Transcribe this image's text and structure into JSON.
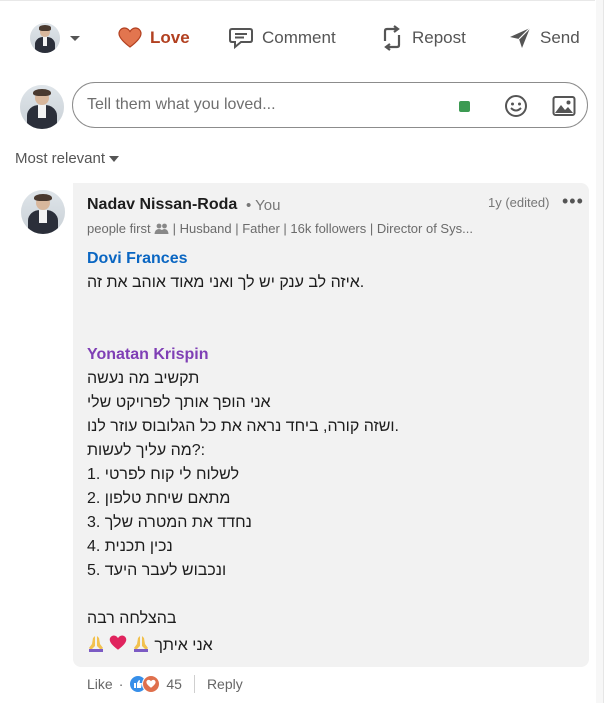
{
  "actions": {
    "love_label": "Love",
    "comment_label": "Comment",
    "repost_label": "Repost",
    "send_label": "Send"
  },
  "composer": {
    "placeholder": "Tell them what you loved..."
  },
  "sort": {
    "label": "Most relevant"
  },
  "comment": {
    "author": "Nadav Nissan-Roda",
    "you_tag": "• You",
    "time": "1y (edited)",
    "more": "•••",
    "headline_prefix": "people first",
    "headline_rest": "| Husband | Father | 16k followers | Director of Sys...",
    "mention1": "Dovi Frances",
    "text1": "איזה לב ענק יש לך ואני מאוד אוהב את זה.",
    "mention2": "Yonatan Krispin",
    "lines": [
      "תקשיב מה נעשה",
      "אני הופך אותך לפרויקט שלי",
      "ושזה קורה, ביחד נראה את כל הגלובוס עוזר לנו.",
      "מה עליך לעשות?:",
      "1. לשלוח לי קוח לפרטי",
      "2. מתאם שיחת טלפון",
      "3. נחדד את המטרה שלך",
      "4. נכין תכנית",
      "5. ונכבוש לעבר היעד"
    ],
    "closing": "בהצלחה רבה",
    "signoff": "אני איתך"
  },
  "reactions": {
    "like_label": "Like",
    "dot": "·",
    "count": "45",
    "reply_label": "Reply"
  },
  "colors": {
    "love": "#b24020",
    "mention_blue": "#0a66c2",
    "mention_purple": "#7f3fb5",
    "bubble": "#f2f2f2"
  }
}
